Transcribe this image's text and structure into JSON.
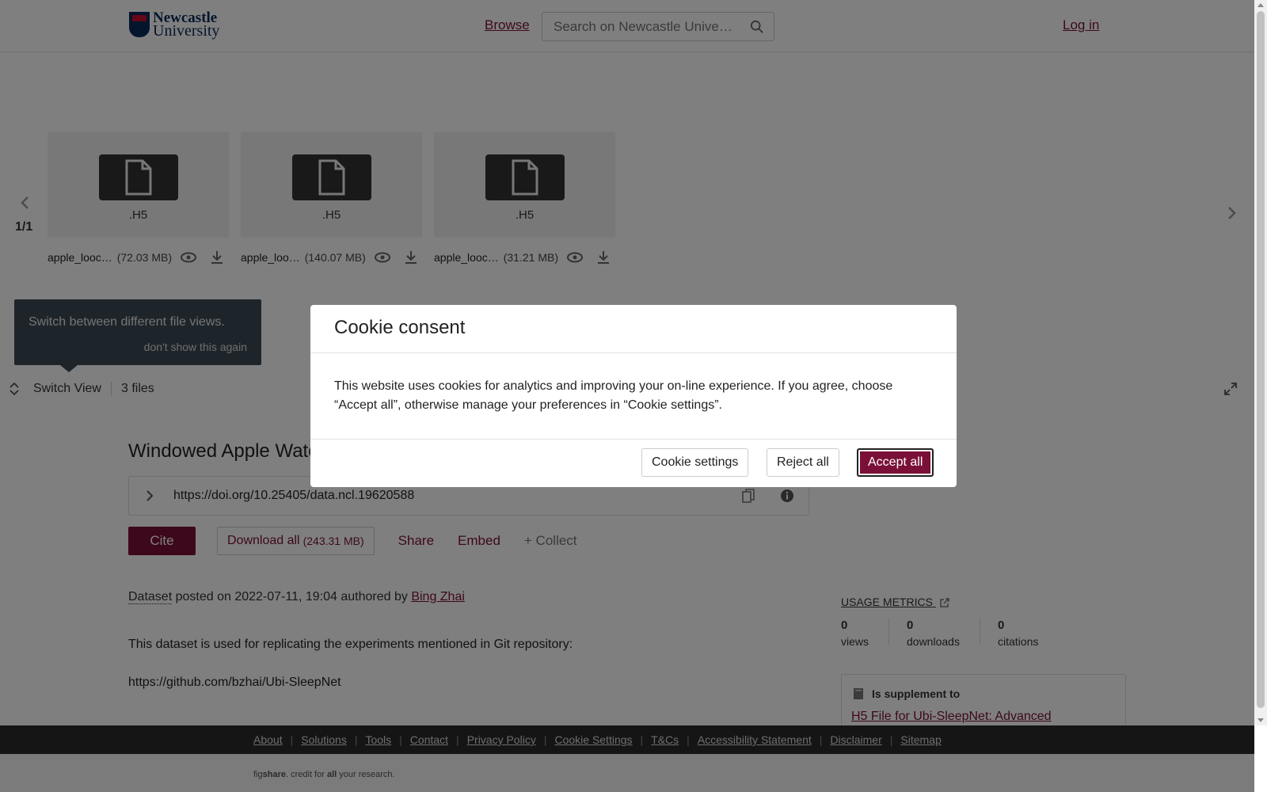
{
  "header": {
    "logo_line1": "Newcastle",
    "logo_line2": "University",
    "browse_label": "Browse",
    "search_placeholder": "Search on Newcastle Unive…",
    "login_label": "Log in"
  },
  "viewer": {
    "pager": "1/1",
    "files": [
      {
        "ext": ".H5",
        "name": "apple_looc…",
        "size": "(72.03 MB)"
      },
      {
        "ext": ".H5",
        "name": "apple_loo…",
        "size": "(140.07 MB)"
      },
      {
        "ext": ".H5",
        "name": "apple_looc…",
        "size": "(31.21 MB)"
      }
    ],
    "tooltip_text": "Switch between different file views.",
    "tooltip_dismiss": "don't show this again",
    "switch_view_label": "Switch View",
    "files_count": "3 files"
  },
  "item": {
    "title": "Windowed Apple Wate",
    "doi": "https://doi.org/10.25405/data.ncl.19620588",
    "cite_label": "Cite",
    "download_label": "Download all",
    "download_size": "(243.31 MB)",
    "share_label": "Share",
    "embed_label": "Embed",
    "collect_label": "+ Collect",
    "type_label": "Dataset",
    "posted_text": "posted on 2022-07-11, 19:04 authored by",
    "author": "Bing Zhai",
    "desc_line1": "This dataset is used for replicating the experiments mentioned in Git repository:",
    "desc_line2": "https://github.com/bzhai/Ubi-SleepNet"
  },
  "metrics": {
    "heading": "USAGE METRICS",
    "views_value": "0",
    "views_label": "views",
    "downloads_value": "0",
    "downloads_label": "downloads",
    "citations_value": "0",
    "citations_label": "citations"
  },
  "supplement": {
    "heading": "Is supplement to",
    "link": "H5 File for Ubi-SleepNet: Advanced"
  },
  "footer": {
    "links": [
      "About",
      "Solutions",
      "Tools",
      "Contact",
      "Privacy Policy",
      "Cookie Settings",
      "T&Cs",
      "Accessibility Statement",
      "Disclaimer",
      "Sitemap"
    ],
    "brand_pre": "fig",
    "brand_bold": "share",
    "brand_mid": ". credit for ",
    "brand_all": "all",
    "brand_post": " your research."
  },
  "modal": {
    "title": "Cookie consent",
    "body": "This website uses cookies for analytics and improving your on-line experience. If you agree, choose “Accept all”, otherwise manage your preferences in “Cookie settings”.",
    "settings_label": "Cookie settings",
    "reject_label": "Reject all",
    "accept_label": "Accept all"
  },
  "colors": {
    "brand": "#7a1037",
    "overlay": "rgba(0,0,0,0.5)"
  }
}
